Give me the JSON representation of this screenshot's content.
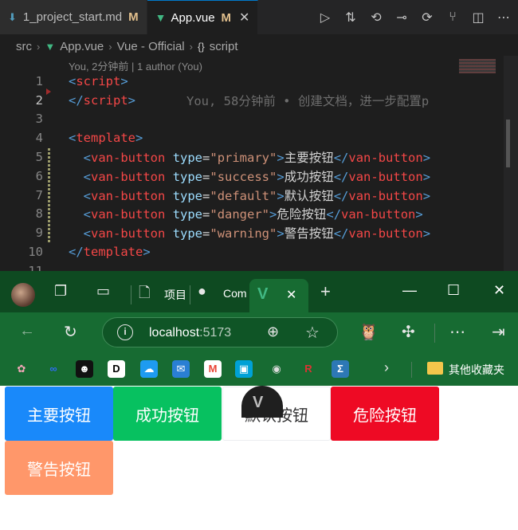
{
  "vscode": {
    "tabs": [
      {
        "label": "1_project_start.md",
        "modified": "M",
        "active": false
      },
      {
        "label": "App.vue",
        "modified": "M",
        "active": true
      }
    ],
    "breadcrumb": {
      "folder": "src",
      "file": "App.vue",
      "language": "Vue - Official",
      "symbol": "script"
    },
    "blame_header": "You, 2分钟前 | 1 author (You)",
    "inline_blame": "You, 58分钟前 • 创建文档，进一步配置p",
    "lines": [
      {
        "n": "1",
        "parts": [
          [
            "tag",
            "<"
          ],
          [
            "tag2",
            "script"
          ],
          [
            "tag",
            ">"
          ]
        ]
      },
      {
        "n": "2",
        "parts": [
          [
            "tag",
            "</"
          ],
          [
            "tag2",
            "script"
          ],
          [
            "tag",
            ">"
          ]
        ]
      },
      {
        "n": "3",
        "parts": []
      },
      {
        "n": "4",
        "parts": [
          [
            "tag",
            "<"
          ],
          [
            "tag2",
            "template"
          ],
          [
            "tag",
            ">"
          ]
        ]
      },
      {
        "n": "5",
        "parts": [
          [
            "txt",
            "  "
          ],
          [
            "tag",
            "<"
          ],
          [
            "tag2",
            "van-button"
          ],
          [
            "txt",
            " "
          ],
          [
            "attr",
            "type"
          ],
          [
            "txt",
            "="
          ],
          [
            "str",
            "\"primary\""
          ],
          [
            "tag",
            ">"
          ],
          [
            "txt",
            "主要按钮"
          ],
          [
            "tag",
            "</"
          ],
          [
            "tag2",
            "van-button"
          ],
          [
            "tag",
            ">"
          ]
        ]
      },
      {
        "n": "6",
        "parts": [
          [
            "txt",
            "  "
          ],
          [
            "tag",
            "<"
          ],
          [
            "tag2",
            "van-button"
          ],
          [
            "txt",
            " "
          ],
          [
            "attr",
            "type"
          ],
          [
            "txt",
            "="
          ],
          [
            "str",
            "\"success\""
          ],
          [
            "tag",
            ">"
          ],
          [
            "txt",
            "成功按钮"
          ],
          [
            "tag",
            "</"
          ],
          [
            "tag2",
            "van-button"
          ],
          [
            "tag",
            ">"
          ]
        ]
      },
      {
        "n": "7",
        "parts": [
          [
            "txt",
            "  "
          ],
          [
            "tag",
            "<"
          ],
          [
            "tag2",
            "van-button"
          ],
          [
            "txt",
            " "
          ],
          [
            "attr",
            "type"
          ],
          [
            "txt",
            "="
          ],
          [
            "str",
            "\"default\""
          ],
          [
            "tag",
            ">"
          ],
          [
            "txt",
            "默认按钮"
          ],
          [
            "tag",
            "</"
          ],
          [
            "tag2",
            "van-button"
          ],
          [
            "tag",
            ">"
          ]
        ]
      },
      {
        "n": "8",
        "parts": [
          [
            "txt",
            "  "
          ],
          [
            "tag",
            "<"
          ],
          [
            "tag2",
            "van-button"
          ],
          [
            "txt",
            " "
          ],
          [
            "attr",
            "type"
          ],
          [
            "txt",
            "="
          ],
          [
            "str",
            "\"danger\""
          ],
          [
            "tag",
            ">"
          ],
          [
            "txt",
            "危险按钮"
          ],
          [
            "tag",
            "</"
          ],
          [
            "tag2",
            "van-button"
          ],
          [
            "tag",
            ">"
          ]
        ]
      },
      {
        "n": "9",
        "parts": [
          [
            "txt",
            "  "
          ],
          [
            "tag",
            "<"
          ],
          [
            "tag2",
            "van-button"
          ],
          [
            "txt",
            " "
          ],
          [
            "attr",
            "type"
          ],
          [
            "txt",
            "="
          ],
          [
            "str",
            "\"warning\""
          ],
          [
            "tag",
            ">"
          ],
          [
            "txt",
            "警告按钮"
          ],
          [
            "tag",
            "</"
          ],
          [
            "tag2",
            "van-button"
          ],
          [
            "tag",
            ">"
          ]
        ]
      },
      {
        "n": "10",
        "parts": [
          [
            "tag",
            "</"
          ],
          [
            "tag2",
            "template"
          ],
          [
            "tag",
            ">"
          ]
        ]
      },
      {
        "n": "11",
        "parts": []
      }
    ],
    "current_line": "2"
  },
  "browser": {
    "tabs": [
      {
        "label": "项目"
      },
      {
        "label": "Com"
      }
    ],
    "new_tab": "+",
    "address": {
      "host": "localhost",
      "port": ":5173"
    },
    "favorites_folder": "其他收藏夹",
    "buttons": {
      "primary": "主要按钮",
      "success": "成功按钮",
      "default": "默认按钮",
      "danger": "危险按钮",
      "warning": "警告按钮"
    }
  },
  "colors": {
    "primary": "#1989fa",
    "success": "#07c160",
    "danger": "#ee0a24",
    "warning": "#ff976a",
    "browser_chrome": "#176b32"
  }
}
